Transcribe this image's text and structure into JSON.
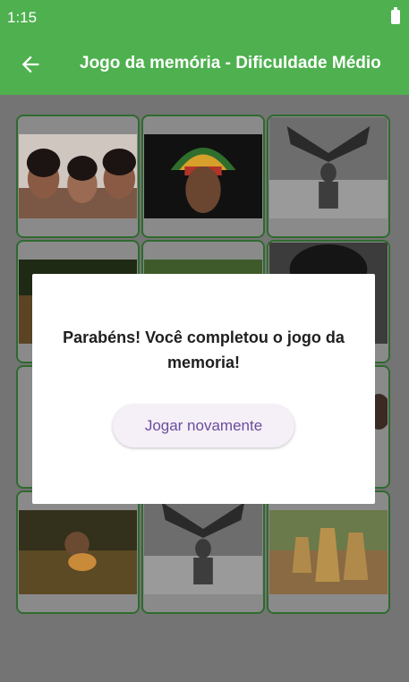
{
  "status_bar": {
    "time": "1:15"
  },
  "app_bar": {
    "title": "Jogo da memória - Dificuldade Médio",
    "back_icon": "arrow-left-icon",
    "color": "#4eb04f"
  },
  "cards": [
    {
      "description": "photo-kids"
    },
    {
      "description": "photo-headdress-man"
    },
    {
      "description": "photo-bw-dancer"
    },
    {
      "description": "photo-river"
    },
    {
      "description": "photo-forest"
    },
    {
      "description": "photo-portrait"
    },
    {
      "description": "photo-hidden"
    },
    {
      "description": "photo-hidden"
    },
    {
      "description": "photo-kids"
    },
    {
      "description": "photo-river-boy"
    },
    {
      "description": "photo-bw-dancer"
    },
    {
      "description": "photo-straw-dancers"
    }
  ],
  "dialog": {
    "message": "Parabéns! Você completou o jogo da memoria!",
    "button_label": "Jogar novamente"
  }
}
